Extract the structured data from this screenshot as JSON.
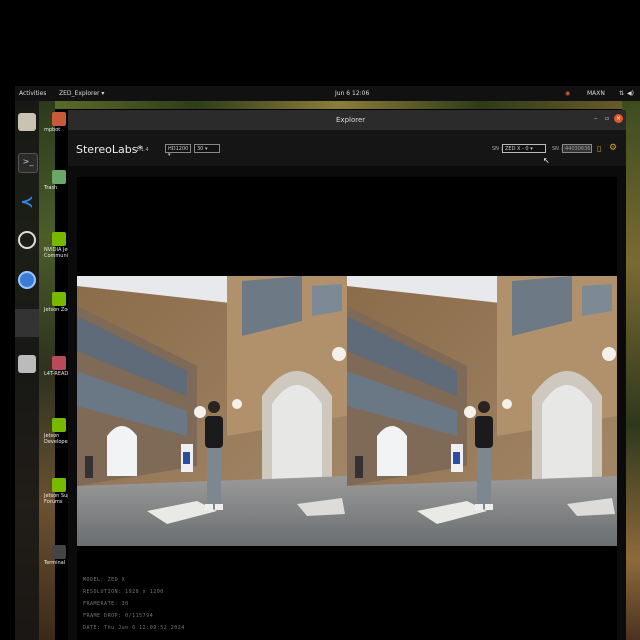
{
  "topbar": {
    "activities": "Activities",
    "app_menu": "ZED_Explorer",
    "clock": "Jun 6  12:06",
    "power_mode": "MAXN"
  },
  "desktop": {
    "items": [
      {
        "label": "mpbot"
      },
      {
        "label": "Trash"
      },
      {
        "label": "NVIDIA Jetson Community"
      },
      {
        "label": "Jetson Zoo"
      },
      {
        "label": "L4T-README"
      },
      {
        "label": "Jetson Developer Z"
      },
      {
        "label": "Jetson Support Forums"
      },
      {
        "label": "Terminal"
      }
    ]
  },
  "window": {
    "title": "Explorer",
    "logo": "StereoLabs*",
    "version": "1.1.4",
    "resolution_select": "HD1200",
    "fps_select": "30",
    "sn_label": "SN :",
    "sn_select": "ZED X - 0",
    "serial_label": "SN :",
    "serial_value": "44030636"
  },
  "info": {
    "model": "MODEL: ZED X",
    "resolution": "RESOLUTION: 1920 x 1200",
    "framerate": "FRAMERATE: 30",
    "frame_drop": "FRAME DROP: 0/115794",
    "date": "DATE: Thu Jun 6 12:09:52 2024"
  }
}
